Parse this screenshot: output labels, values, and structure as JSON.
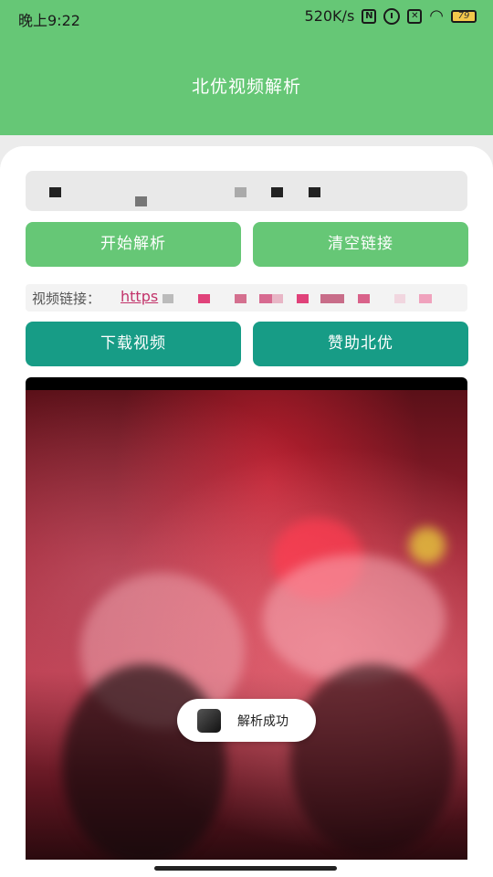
{
  "status_bar": {
    "time": "晚上9:22",
    "network_speed": "520K/s",
    "nfc_icon": "N",
    "battery_level": "79",
    "icons": [
      "nfc-icon",
      "alarm-icon",
      "sim-icon",
      "wifi-icon",
      "battery-icon"
    ]
  },
  "header": {
    "title": "北优视频解析",
    "color": "#66c776"
  },
  "input": {
    "value": "",
    "placeholder": ""
  },
  "buttons": {
    "start_parse": "开始解析",
    "clear_link": "清空链接",
    "download_video": "下载视频",
    "sponsor": "赞助北优"
  },
  "link": {
    "label": "视频链接：",
    "url_text": "https"
  },
  "toast": {
    "message": "解析成功"
  },
  "colors": {
    "accent_green": "#66c776",
    "accent_teal": "#179c86",
    "link": "#c2336a"
  }
}
